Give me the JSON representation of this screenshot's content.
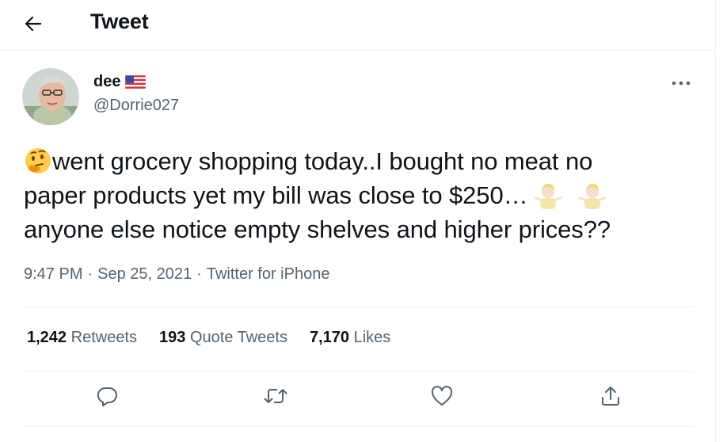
{
  "header": {
    "title": "Tweet",
    "back_icon": "arrow-left-icon"
  },
  "author": {
    "name": "dee",
    "handle": "@Dorrie027",
    "flag_icon": "us-flag-icon",
    "avatar_icon": "profile-photo"
  },
  "tweet": {
    "lead_emoji": "thinking-face-emoji",
    "line1": "went grocery shopping today..I bought no meat no",
    "line2": "paper products yet my bill was close to $250…",
    "shrug_emoji": "person-shrugging-emoji",
    "line3": "anyone else notice empty shelves and higher prices??"
  },
  "meta": {
    "time": "9:47 PM",
    "sep": "·",
    "date": "Sep 25, 2021",
    "source": "Twitter for iPhone"
  },
  "stats": {
    "retweets_count": "1,242",
    "retweets_label": "Retweets",
    "quotes_count": "193",
    "quotes_label": "Quote Tweets",
    "likes_count": "7,170",
    "likes_label": "Likes"
  },
  "actions": {
    "reply_icon": "reply-icon",
    "retweet_icon": "retweet-icon",
    "like_icon": "heart-icon",
    "share_icon": "share-icon"
  },
  "colors": {
    "text": "#0f1419",
    "secondary": "#536471",
    "divider": "#eff3f4"
  }
}
